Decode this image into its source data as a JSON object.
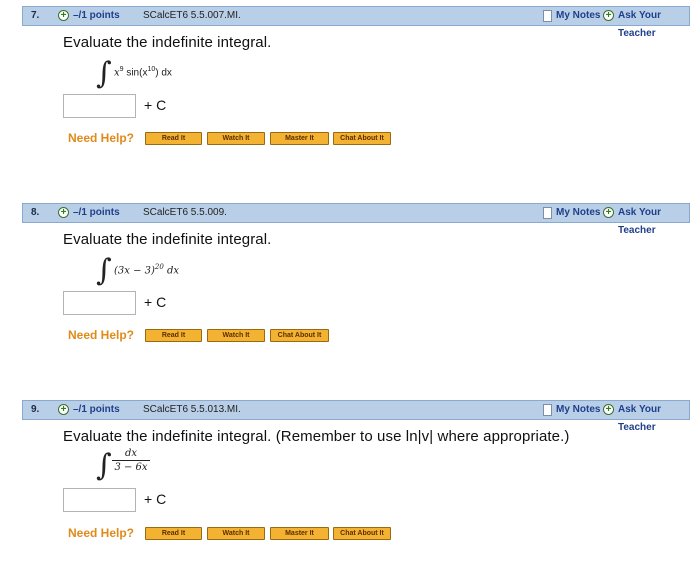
{
  "questions": [
    {
      "number": "7.",
      "points": "–/1 points",
      "source": "SCalcET6 5.5.007.MI.",
      "my_notes": "My Notes",
      "ask_teacher": "Ask Your Teacher",
      "prompt": "Evaluate the indefinite integral.",
      "integral": {
        "base": "x",
        "exp1": "9",
        "func": " sin(x",
        "exp2": "10",
        "tail": ") dx"
      },
      "plus_c": "+ C",
      "need_help": "Need Help?",
      "buttons": [
        "Read It",
        "Watch It",
        "Master It",
        "Chat About It"
      ]
    },
    {
      "number": "8.",
      "points": "–/1 points",
      "source": "SCalcET6 5.5.009.",
      "my_notes": "My Notes",
      "ask_teacher": "Ask Your Teacher",
      "prompt": "Evaluate the indefinite integral.",
      "integral": {
        "body": "(3x − 3)",
        "exp": "20",
        "tail": " dx"
      },
      "plus_c": "+ C",
      "need_help": "Need Help?",
      "buttons": [
        "Read It",
        "Watch It",
        "Chat About It"
      ]
    },
    {
      "number": "9.",
      "points": "–/1 points",
      "source": "SCalcET6 5.5.013.MI.",
      "my_notes": "My Notes",
      "ask_teacher": "Ask Your Teacher",
      "prompt": "Evaluate the indefinite integral. (Remember to use ln|v| where appropriate.)",
      "integral": {
        "numerator": "dx",
        "denominator": "3 − 6x"
      },
      "plus_c": "+ C",
      "need_help": "Need Help?",
      "buttons": [
        "Read It",
        "Watch It",
        "Master It",
        "Chat About It"
      ]
    }
  ],
  "icons": {
    "add": "plus-circle-icon",
    "notes": "note-icon"
  },
  "colors": {
    "header_bg": "#b9cfe8",
    "button_bg": "#f4b233",
    "need_help": "#e08a1a",
    "link": "#1f3f8a"
  }
}
